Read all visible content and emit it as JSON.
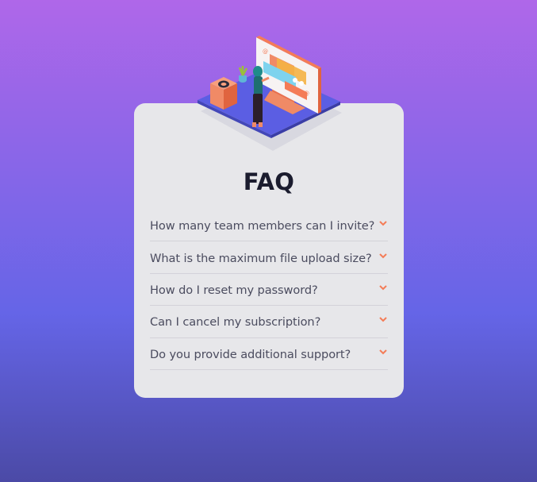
{
  "faq": {
    "title": "FAQ",
    "items": [
      {
        "question": "How many team members can I invite?",
        "icon": "chevron-down-icon"
      },
      {
        "question": "What is the maximum file upload size?",
        "icon": "chevron-down-icon"
      },
      {
        "question": "How do I reset my password?",
        "icon": "chevron-down-icon"
      },
      {
        "question": "Can I cancel my subscription?",
        "icon": "chevron-down-icon"
      },
      {
        "question": "Do you provide additional support?",
        "icon": "chevron-down-icon"
      }
    ]
  },
  "colors": {
    "background_top": "#af67e9",
    "background_bottom": "#4b4aa6",
    "card": "#e7e7ea",
    "title": "#1b1c2e",
    "question": "#4b4c5f",
    "divider": "#d3d2d9",
    "accent": "#f47c57"
  },
  "illustration": {
    "name": "woman-at-computer-illustration"
  }
}
